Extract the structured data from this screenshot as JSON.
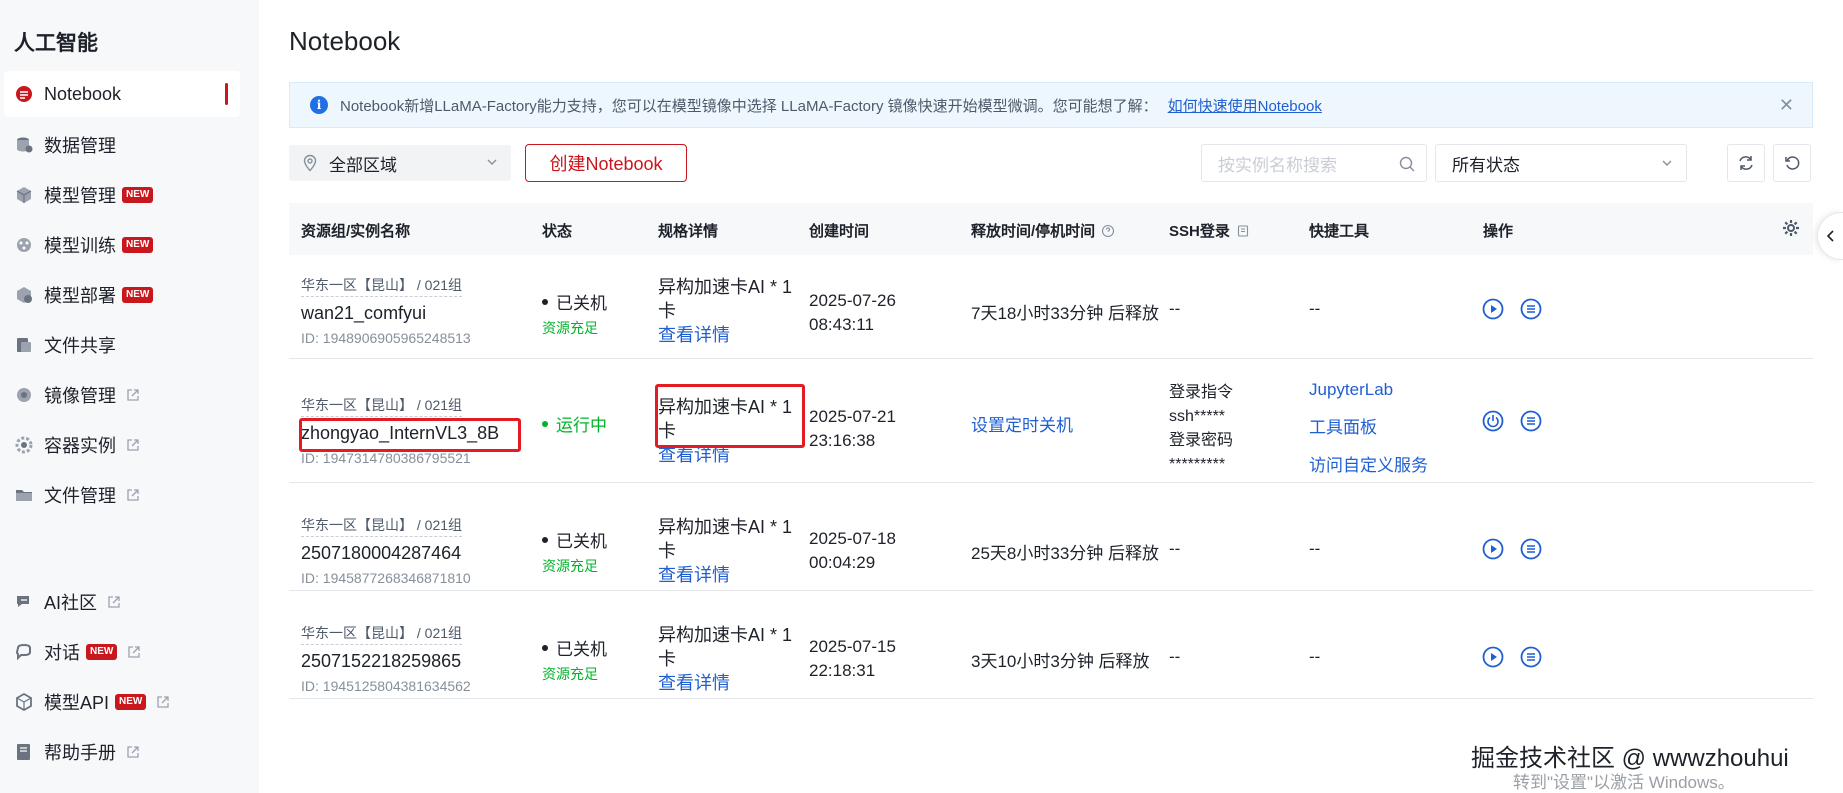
{
  "sidebar": {
    "title": "人工智能",
    "items": [
      {
        "label": "Notebook",
        "icon": "notebook-icon",
        "badge": "",
        "external": false
      },
      {
        "label": "数据管理",
        "icon": "database-icon",
        "badge": "",
        "external": false
      },
      {
        "label": "模型管理",
        "icon": "cube-icon",
        "badge": "NEW",
        "external": false
      },
      {
        "label": "模型训练",
        "icon": "training-icon",
        "badge": "NEW",
        "external": false
      },
      {
        "label": "模型部署",
        "icon": "deploy-icon",
        "badge": "NEW",
        "external": false
      },
      {
        "label": "文件共享",
        "icon": "share-icon",
        "badge": "",
        "external": false
      },
      {
        "label": "镜像管理",
        "icon": "image-icon",
        "badge": "",
        "external": true
      },
      {
        "label": "容器实例",
        "icon": "container-icon",
        "badge": "",
        "external": true
      },
      {
        "label": "文件管理",
        "icon": "folder-icon",
        "badge": "",
        "external": true
      },
      {
        "label": "AI社区",
        "icon": "community-icon",
        "badge": "",
        "external": true
      },
      {
        "label": "对话",
        "icon": "chat-icon",
        "badge": "NEW",
        "external": true
      },
      {
        "label": "模型API",
        "icon": "api-icon",
        "badge": "NEW",
        "external": true
      },
      {
        "label": "帮助手册",
        "icon": "book-icon",
        "badge": "",
        "external": true
      }
    ]
  },
  "main": {
    "title": "Notebook",
    "notice": {
      "text": "Notebook新增LLaMA-Factory能力支持，您可以在模型镜像中选择 LLaMA-Factory 镜像快速开始模型微调。您可能想了解：",
      "link": "如何快速使用Notebook"
    },
    "toolbar": {
      "region": "全部区域",
      "create_label": "创建Notebook",
      "search_placeholder": "按实例名称搜索",
      "status_filter": "所有状态"
    },
    "table": {
      "headers": {
        "name": "资源组/实例名称",
        "state": "状态",
        "spec": "规格详情",
        "created": "创建时间",
        "release": "释放时间/停机时间",
        "ssh": "SSH登录",
        "tools": "快捷工具",
        "ops": "操作"
      },
      "rows": [
        {
          "location": "华东一区【昆山】 / 021组",
          "name": "wan21_comfyui",
          "id": "ID: 1948906905965248513",
          "state": "已关机",
          "resource": "资源充足",
          "spec_line1": "异构加速卡AI * 1",
          "spec_line2": "卡",
          "spec_detail": "查看详情",
          "created_date": "2025-07-26",
          "created_time": "08:43:11",
          "release": "7天18小时33分钟 后释放",
          "ssh": "--",
          "tools": "--"
        },
        {
          "location": "华东一区【昆山】 / 021组",
          "name": "zhongyao_InternVL3_8B",
          "id": "ID: 1947314780386795521",
          "state": "运行中",
          "resource": "",
          "spec_line1": "异构加速卡AI * 1",
          "spec_line2": "卡",
          "spec_detail": "查看详情",
          "created_date": "2025-07-21",
          "created_time": "23:16:38",
          "release": "设置定时关机",
          "ssh_cmd_label": "登录指令",
          "ssh_cmd": "ssh*****",
          "ssh_pwd_label": "登录密码",
          "ssh_pwd": "*********",
          "tool1": "JupyterLab",
          "tool2": "工具面板",
          "tool3": "访问自定义服务"
        },
        {
          "location": "华东一区【昆山】 / 021组",
          "name": "2507180004287464",
          "id": "ID: 1945877268346871810",
          "state": "已关机",
          "resource": "资源充足",
          "spec_line1": "异构加速卡AI * 1",
          "spec_line2": "卡",
          "spec_detail": "查看详情",
          "created_date": "2025-07-18",
          "created_time": "00:04:29",
          "release": "25天8小时33分钟 后释放",
          "ssh": "--",
          "tools": "--"
        },
        {
          "location": "华东一区【昆山】 / 021组",
          "name": "2507152218259865",
          "id": "ID: 1945125804381634562",
          "state": "已关机",
          "resource": "资源充足",
          "spec_line1": "异构加速卡AI * 1",
          "spec_line2": "卡",
          "spec_detail": "查看详情",
          "created_date": "2025-07-15",
          "created_time": "22:18:31",
          "release": "3天10小时3分钟 后释放",
          "ssh": "--",
          "tools": "--"
        }
      ]
    }
  },
  "overlay": {
    "watermark": "掘金技术社区 @ wwwzhouhui",
    "activate": "转到\"设置\"以激活 Windows。"
  },
  "colors": {
    "brand": "#c9171e",
    "link": "#1f5fd1",
    "running": "#00b42a",
    "highlight": "#e31b23"
  }
}
